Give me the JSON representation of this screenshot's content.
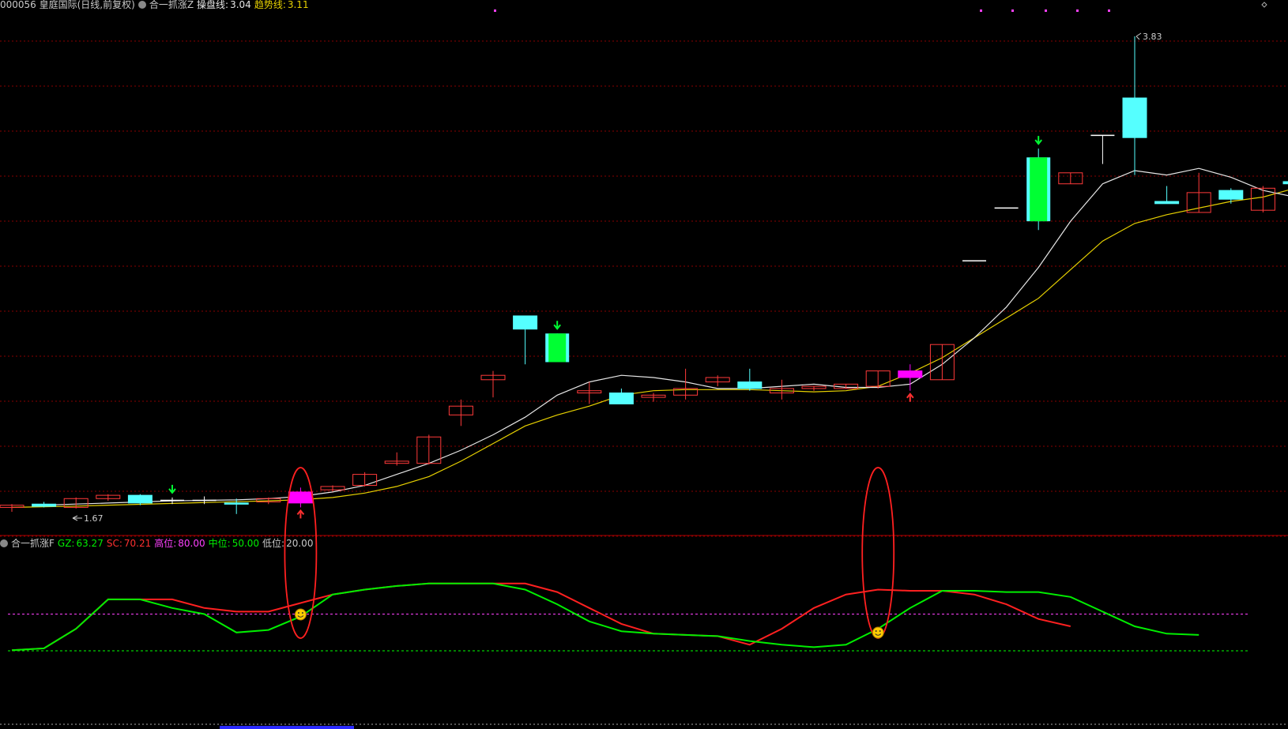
{
  "header_main": {
    "stock": "000056 皇庭国际(日线,前复权)",
    "indicator": "合一抓涨Z",
    "line1_label": "操盘线:",
    "line1_value": "3.04",
    "line2_label": "趋势线:",
    "line2_value": "3.11"
  },
  "header_sub": {
    "indicator": "合一抓涨F",
    "gz_label": "GZ:",
    "gz_value": "63.27",
    "sc_label": "SC:",
    "sc_value": "70.21",
    "high_label": "高位:",
    "high_value": "80.00",
    "mid_label": "中位:",
    "mid_value": "50.00",
    "low_label": "低位:",
    "low_value": "20.00"
  },
  "colors": {
    "background": "#000000",
    "up": "#ff3a3a",
    "down": "#55ffff",
    "signal": "#ff00ff",
    "green_candle": "#00ff33",
    "line_white": "#e6e6e6",
    "line_yellow": "#e6d000",
    "sc": "#ff2020",
    "gz": "#00ee00",
    "high_level": "#ff40ff",
    "mid_level": "#00ff00",
    "grid": "#8a0000"
  },
  "chart_data": {
    "type": "candlestick",
    "annotations": {
      "max_label": "3.83",
      "min_label": "1.67"
    },
    "candles": [
      {
        "o": 1.69,
        "h": 1.705,
        "l": 1.67,
        "c": 1.7,
        "kind": "up"
      },
      {
        "o": 1.705,
        "h": 1.715,
        "l": 1.69,
        "c": 1.695,
        "kind": "down"
      },
      {
        "o": 1.69,
        "h": 1.735,
        "l": 1.685,
        "c": 1.73,
        "kind": "up"
      },
      {
        "o": 1.73,
        "h": 1.75,
        "l": 1.72,
        "c": 1.745,
        "kind": "up"
      },
      {
        "o": 1.745,
        "h": 1.75,
        "l": 1.7,
        "c": 1.71,
        "kind": "down"
      },
      {
        "o": 1.718,
        "h": 1.735,
        "l": 1.705,
        "c": 1.722,
        "kind": "doji",
        "arrow": "down"
      },
      {
        "o": 1.72,
        "h": 1.74,
        "l": 1.705,
        "c": 1.722,
        "kind": "doji"
      },
      {
        "o": 1.71,
        "h": 1.73,
        "l": 1.66,
        "c": 1.705,
        "kind": "down"
      },
      {
        "o": 1.715,
        "h": 1.735,
        "l": 1.705,
        "c": 1.73,
        "kind": "up"
      },
      {
        "o": 1.71,
        "h": 1.78,
        "l": 1.69,
        "c": 1.76,
        "kind": "signal",
        "arrow": "up"
      },
      {
        "o": 1.77,
        "h": 1.79,
        "l": 1.765,
        "c": 1.785,
        "kind": "up"
      },
      {
        "o": 1.79,
        "h": 1.85,
        "l": 1.785,
        "c": 1.84,
        "kind": "up"
      },
      {
        "o": 1.89,
        "h": 1.94,
        "l": 1.88,
        "c": 1.9,
        "kind": "up"
      },
      {
        "o": 1.89,
        "h": 2.02,
        "l": 1.885,
        "c": 2.01,
        "kind": "up"
      },
      {
        "o": 2.11,
        "h": 2.18,
        "l": 2.06,
        "c": 2.15,
        "kind": "up"
      },
      {
        "o": 2.29,
        "h": 2.31,
        "l": 2.19,
        "c": 2.27,
        "kind": "up"
      },
      {
        "o": 2.56,
        "h": 2.56,
        "l": 2.34,
        "c": 2.5,
        "kind": "down"
      },
      {
        "o": 2.48,
        "h": 2.48,
        "l": 2.35,
        "c": 2.35,
        "kind": "green",
        "arrow": "down"
      },
      {
        "o": 2.21,
        "h": 2.26,
        "l": 2.16,
        "c": 2.22,
        "kind": "up"
      },
      {
        "o": 2.21,
        "h": 2.23,
        "l": 2.16,
        "c": 2.16,
        "kind": "down"
      },
      {
        "o": 2.19,
        "h": 2.21,
        "l": 2.17,
        "c": 2.2,
        "kind": "up"
      },
      {
        "o": 2.2,
        "h": 2.32,
        "l": 2.18,
        "c": 2.23,
        "kind": "up"
      },
      {
        "o": 2.26,
        "h": 2.29,
        "l": 2.24,
        "c": 2.28,
        "kind": "up"
      },
      {
        "o": 2.26,
        "h": 2.32,
        "l": 2.22,
        "c": 2.23,
        "kind": "down"
      },
      {
        "o": 2.21,
        "h": 2.27,
        "l": 2.18,
        "c": 2.23,
        "kind": "up"
      },
      {
        "o": 2.23,
        "h": 2.24,
        "l": 2.22,
        "c": 2.24,
        "kind": "up"
      },
      {
        "o": 2.23,
        "h": 2.25,
        "l": 2.23,
        "c": 2.25,
        "kind": "up"
      },
      {
        "o": 2.24,
        "h": 2.31,
        "l": 2.23,
        "c": 2.31,
        "kind": "up"
      },
      {
        "o": 2.28,
        "h": 2.34,
        "l": 2.22,
        "c": 2.31,
        "kind": "signal",
        "arrow": "up"
      },
      {
        "o": 2.27,
        "h": 2.43,
        "l": 2.27,
        "c": 2.43,
        "kind": "up"
      },
      {
        "o": 2.81,
        "h": 2.81,
        "l": 2.81,
        "c": 2.81,
        "kind": "flat"
      },
      {
        "o": 3.05,
        "h": 3.05,
        "l": 3.05,
        "c": 3.05,
        "kind": "flat"
      },
      {
        "o": 3.28,
        "h": 3.32,
        "l": 2.95,
        "c": 2.99,
        "kind": "green",
        "arrow": "down"
      },
      {
        "o": 3.16,
        "h": 3.21,
        "l": 3.16,
        "c": 3.21,
        "kind": "up"
      },
      {
        "o": 3.38,
        "h": 3.38,
        "l": 3.25,
        "c": 3.38,
        "kind": "t"
      },
      {
        "o": 3.55,
        "h": 3.83,
        "l": 3.2,
        "c": 3.37,
        "kind": "down"
      },
      {
        "o": 3.08,
        "h": 3.15,
        "l": 3.07,
        "c": 3.07,
        "kind": "down"
      },
      {
        "o": 3.03,
        "h": 3.21,
        "l": 3.03,
        "c": 3.12,
        "kind": "up"
      },
      {
        "o": 3.13,
        "h": 3.14,
        "l": 3.07,
        "c": 3.09,
        "kind": "down"
      },
      {
        "o": 3.04,
        "h": 3.15,
        "l": 3.03,
        "c": 3.14,
        "kind": "up"
      },
      {
        "o": 3.17,
        "h": 3.3,
        "l": 3.14,
        "c": 3.16,
        "kind": "down"
      }
    ],
    "white_line": [
      null,
      1.7,
      1.705,
      1.71,
      1.715,
      1.72,
      1.722,
      1.724,
      1.73,
      1.74,
      1.76,
      1.79,
      1.84,
      1.89,
      1.95,
      2.02,
      2.1,
      2.2,
      2.26,
      2.29,
      2.28,
      2.26,
      2.23,
      2.23,
      2.24,
      2.25,
      2.235,
      2.235,
      2.25,
      2.34,
      2.46,
      2.6,
      2.78,
      2.99,
      3.16,
      3.22,
      3.2,
      3.23,
      3.19,
      3.13,
      3.1
    ],
    "yellow_line": [
      1.69,
      1.693,
      1.696,
      1.7,
      1.704,
      1.708,
      1.712,
      1.716,
      1.72,
      1.725,
      1.735,
      1.755,
      1.785,
      1.83,
      1.9,
      1.98,
      2.06,
      2.11,
      2.15,
      2.2,
      2.22,
      2.225,
      2.225,
      2.225,
      2.22,
      2.215,
      2.22,
      2.24,
      2.3,
      2.37,
      2.46,
      2.55,
      2.64,
      2.77,
      2.9,
      2.98,
      3.02,
      3.05,
      3.08,
      3.1,
      3.14
    ],
    "oscillator": {
      "SC": [
        20.5,
        22,
        38,
        62,
        62,
        62,
        55,
        52,
        52,
        59,
        66,
        70,
        73,
        75,
        75,
        75,
        75,
        68,
        55,
        42,
        34,
        33,
        32,
        25,
        38,
        55,
        66,
        70,
        69,
        69,
        66,
        58,
        46,
        40
      ],
      "GZ": [
        20.5,
        22,
        38,
        62,
        62,
        55,
        50,
        35,
        37,
        48,
        66,
        70,
        73,
        75,
        75,
        75,
        70,
        58,
        44,
        36,
        34,
        33,
        32,
        28,
        25,
        23,
        25,
        38,
        55,
        69,
        69,
        68,
        68,
        64,
        52,
        40,
        34,
        33
      ],
      "high": 50.0,
      "low": 20.0,
      "signals": [
        9,
        27
      ]
    }
  }
}
